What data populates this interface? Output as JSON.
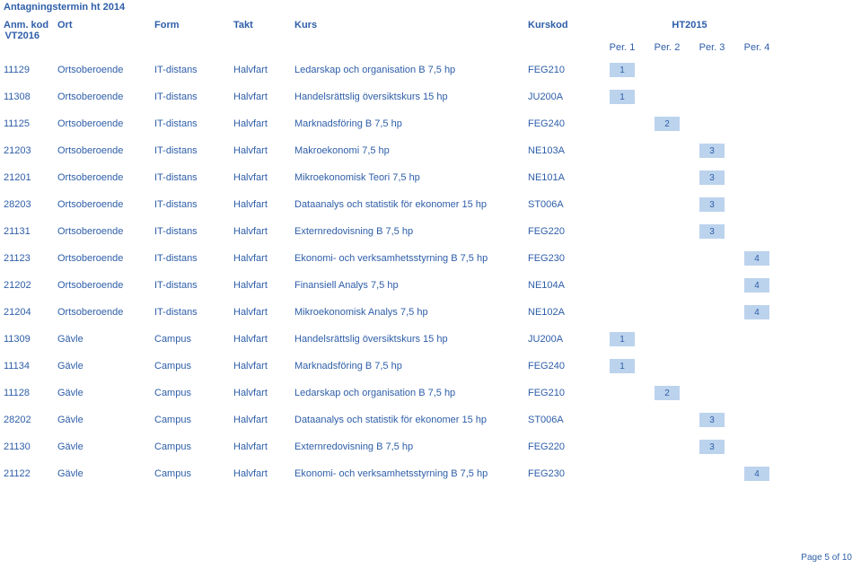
{
  "title": "Antagningstermin ht 2014",
  "header": {
    "anm_kod": "Anm. kod",
    "ort": "Ort",
    "form": "Form",
    "takt": "Takt",
    "kurs": "Kurs",
    "kurskod": "Kurskod",
    "ht2015": "HT2015",
    "vt2016": "VT2016",
    "per1": "Per. 1",
    "per2": "Per. 2",
    "per3": "Per. 3",
    "per4": "Per. 4"
  },
  "rows": [
    {
      "kod": "11129",
      "ort": "Ortsoberoende",
      "form": "IT-distans",
      "takt": "Halvfart",
      "kurs": "Ledarskap och organisation B 7,5 hp",
      "kurskod": "FEG210",
      "p1": "1",
      "p2": "",
      "p3": "",
      "p4": ""
    },
    {
      "kod": "11308",
      "ort": "Ortsoberoende",
      "form": "IT-distans",
      "takt": "Halvfart",
      "kurs": "Handelsrättslig översiktskurs 15 hp",
      "kurskod": "JU200A",
      "p1": "1",
      "p2": "",
      "p3": "",
      "p4": ""
    },
    {
      "kod": "11125",
      "ort": "Ortsoberoende",
      "form": "IT-distans",
      "takt": "Halvfart",
      "kurs": "Marknadsföring B 7,5 hp",
      "kurskod": "FEG240",
      "p1": "",
      "p2": "2",
      "p3": "",
      "p4": ""
    },
    {
      "kod": "21203",
      "ort": "Ortsoberoende",
      "form": "IT-distans",
      "takt": "Halvfart",
      "kurs": "Makroekonomi 7,5 hp",
      "kurskod": "NE103A",
      "p1": "",
      "p2": "",
      "p3": "3",
      "p4": ""
    },
    {
      "kod": "21201",
      "ort": "Ortsoberoende",
      "form": "IT-distans",
      "takt": "Halvfart",
      "kurs": "Mikroekonomisk Teori 7,5 hp",
      "kurskod": "NE101A",
      "p1": "",
      "p2": "",
      "p3": "3",
      "p4": ""
    },
    {
      "kod": "28203",
      "ort": "Ortsoberoende",
      "form": "IT-distans",
      "takt": "Halvfart",
      "kurs": "Dataanalys och statistik för ekonomer 15 hp",
      "kurskod": "ST006A",
      "p1": "",
      "p2": "",
      "p3": "3",
      "p4": ""
    },
    {
      "kod": "21131",
      "ort": "Ortsoberoende",
      "form": "IT-distans",
      "takt": "Halvfart",
      "kurs": "Externredovisning B 7,5 hp",
      "kurskod": "FEG220",
      "p1": "",
      "p2": "",
      "p3": "3",
      "p4": ""
    },
    {
      "kod": "21123",
      "ort": "Ortsoberoende",
      "form": "IT-distans",
      "takt": "Halvfart",
      "kurs": "Ekonomi- och verksamhetsstyrning B 7,5 hp",
      "kurskod": "FEG230",
      "p1": "",
      "p2": "",
      "p3": "",
      "p4": "4"
    },
    {
      "kod": "21202",
      "ort": "Ortsoberoende",
      "form": "IT-distans",
      "takt": "Halvfart",
      "kurs": "Finansiell Analys 7,5 hp",
      "kurskod": "NE104A",
      "p1": "",
      "p2": "",
      "p3": "",
      "p4": "4"
    },
    {
      "kod": "21204",
      "ort": "Ortsoberoende",
      "form": "IT-distans",
      "takt": "Halvfart",
      "kurs": "Mikroekonomisk Analys 7,5 hp",
      "kurskod": "NE102A",
      "p1": "",
      "p2": "",
      "p3": "",
      "p4": "4"
    },
    {
      "kod": "11309",
      "ort": "Gävle",
      "form": "Campus",
      "takt": "Halvfart",
      "kurs": "Handelsrättslig översiktskurs 15 hp",
      "kurskod": "JU200A",
      "p1": "1",
      "p2": "",
      "p3": "",
      "p4": ""
    },
    {
      "kod": "11134",
      "ort": "Gävle",
      "form": "Campus",
      "takt": "Halvfart",
      "kurs": "Marknadsföring B 7,5 hp",
      "kurskod": "FEG240",
      "p1": "1",
      "p2": "",
      "p3": "",
      "p4": ""
    },
    {
      "kod": "11128",
      "ort": "Gävle",
      "form": "Campus",
      "takt": "Halvfart",
      "kurs": "Ledarskap och organisation B 7,5 hp",
      "kurskod": "FEG210",
      "p1": "",
      "p2": "2",
      "p3": "",
      "p4": ""
    },
    {
      "kod": "28202",
      "ort": "Gävle",
      "form": "Campus",
      "takt": "Halvfart",
      "kurs": "Dataanalys och statistik för ekonomer 15 hp",
      "kurskod": "ST006A",
      "p1": "",
      "p2": "",
      "p3": "3",
      "p4": ""
    },
    {
      "kod": "21130",
      "ort": "Gävle",
      "form": "Campus",
      "takt": "Halvfart",
      "kurs": "Externredovisning B 7,5 hp",
      "kurskod": "FEG220",
      "p1": "",
      "p2": "",
      "p3": "3",
      "p4": ""
    },
    {
      "kod": "21122",
      "ort": "Gävle",
      "form": "Campus",
      "takt": "Halvfart",
      "kurs": "Ekonomi- och verksamhetsstyrning B 7,5 hp",
      "kurskod": "FEG230",
      "p1": "",
      "p2": "",
      "p3": "",
      "p4": "4"
    }
  ],
  "footer": "Page 5 of 10"
}
